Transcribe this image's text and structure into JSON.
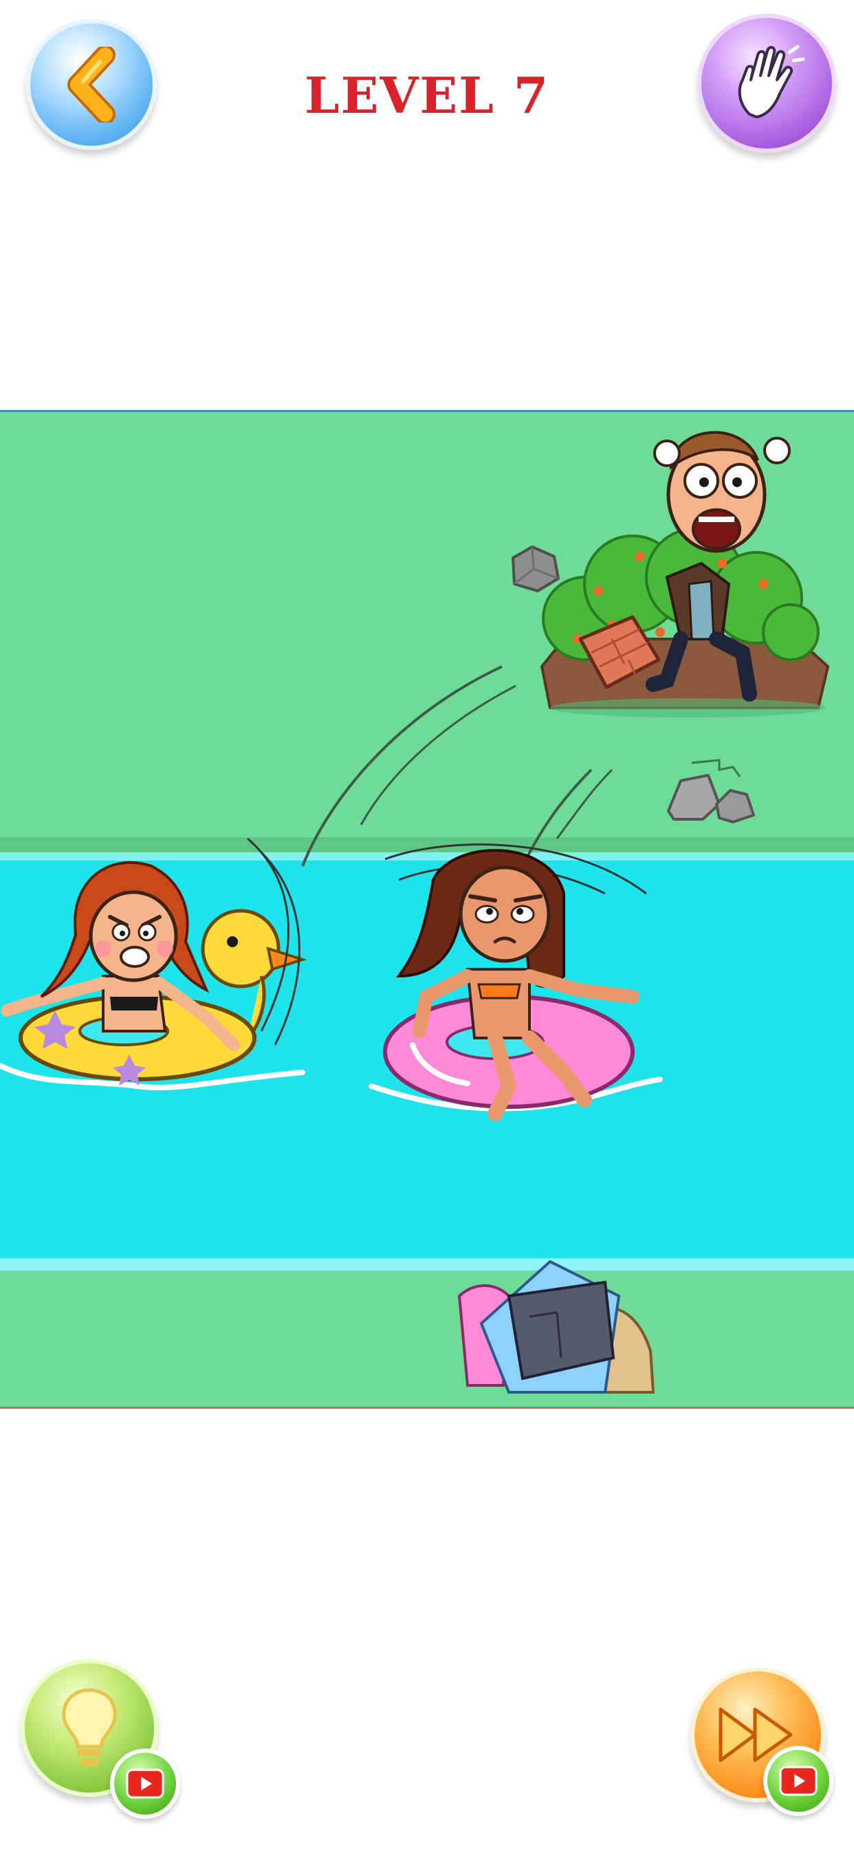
{
  "header": {
    "level_title": "LEVEL 7",
    "back_icon": "chevron-left-icon",
    "hand_icon": "waving-hand-icon"
  },
  "scene": {
    "characters": [
      "angry-girl-on-duck-float",
      "annoyed-girl-on-pink-ring",
      "screaming-man-behind-bush"
    ],
    "props": [
      "thrown-rock",
      "brick",
      "bush",
      "rocks",
      "pile-of-clothes"
    ]
  },
  "footer": {
    "hint_icon": "lightbulb-icon",
    "skip_icon": "fast-forward-icon",
    "video_icon": "play-video-icon"
  },
  "colors": {
    "level_title": "#d8232a",
    "grass": "#6edc96",
    "water": "#1ee3ea",
    "hint_button": "#86c93e",
    "skip_button": "#ff8c1a",
    "hand_button": "#a55de0",
    "back_button": "#5fb4f4"
  }
}
